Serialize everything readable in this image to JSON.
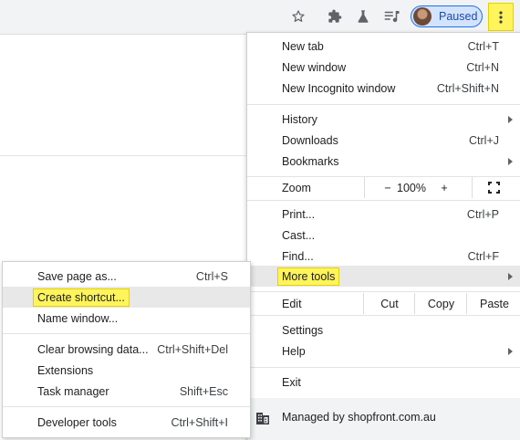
{
  "toolbar": {
    "profile_label": "Paused",
    "icons": [
      "star-icon",
      "extensions-icon",
      "labs-icon",
      "media-queue-icon",
      "menu-dots-icon"
    ]
  },
  "menu": {
    "new_tab": {
      "label": "New tab",
      "shortcut": "Ctrl+T"
    },
    "new_window": {
      "label": "New window",
      "shortcut": "Ctrl+N"
    },
    "new_incognito": {
      "label": "New Incognito window",
      "shortcut": "Ctrl+Shift+N"
    },
    "history": {
      "label": "History"
    },
    "downloads": {
      "label": "Downloads",
      "shortcut": "Ctrl+J"
    },
    "bookmarks": {
      "label": "Bookmarks"
    },
    "zoom": {
      "label": "Zoom",
      "minus": "−",
      "value": "100%",
      "plus": "+"
    },
    "print": {
      "label": "Print...",
      "shortcut": "Ctrl+P"
    },
    "cast": {
      "label": "Cast..."
    },
    "find": {
      "label": "Find...",
      "shortcut": "Ctrl+F"
    },
    "more_tools": {
      "label": "More tools"
    },
    "edit": {
      "label": "Edit",
      "cut": "Cut",
      "copy": "Copy",
      "paste": "Paste"
    },
    "settings": {
      "label": "Settings"
    },
    "help": {
      "label": "Help"
    },
    "exit": {
      "label": "Exit"
    },
    "managed": {
      "label": "Managed by shopfront.com.au"
    }
  },
  "submenu": {
    "save_page": {
      "label": "Save page as...",
      "shortcut": "Ctrl+S"
    },
    "create_shortcut": {
      "label": "Create shortcut..."
    },
    "name_window": {
      "label": "Name window..."
    },
    "clear_data": {
      "label": "Clear browsing data...",
      "shortcut": "Ctrl+Shift+Del"
    },
    "extensions": {
      "label": "Extensions"
    },
    "task_manager": {
      "label": "Task manager",
      "shortcut": "Shift+Esc"
    },
    "dev_tools": {
      "label": "Developer tools",
      "shortcut": "Ctrl+Shift+I"
    }
  },
  "colors": {
    "highlight": "#fff45c",
    "hover": "#e8e8e8",
    "accent": "#1a73e8"
  }
}
